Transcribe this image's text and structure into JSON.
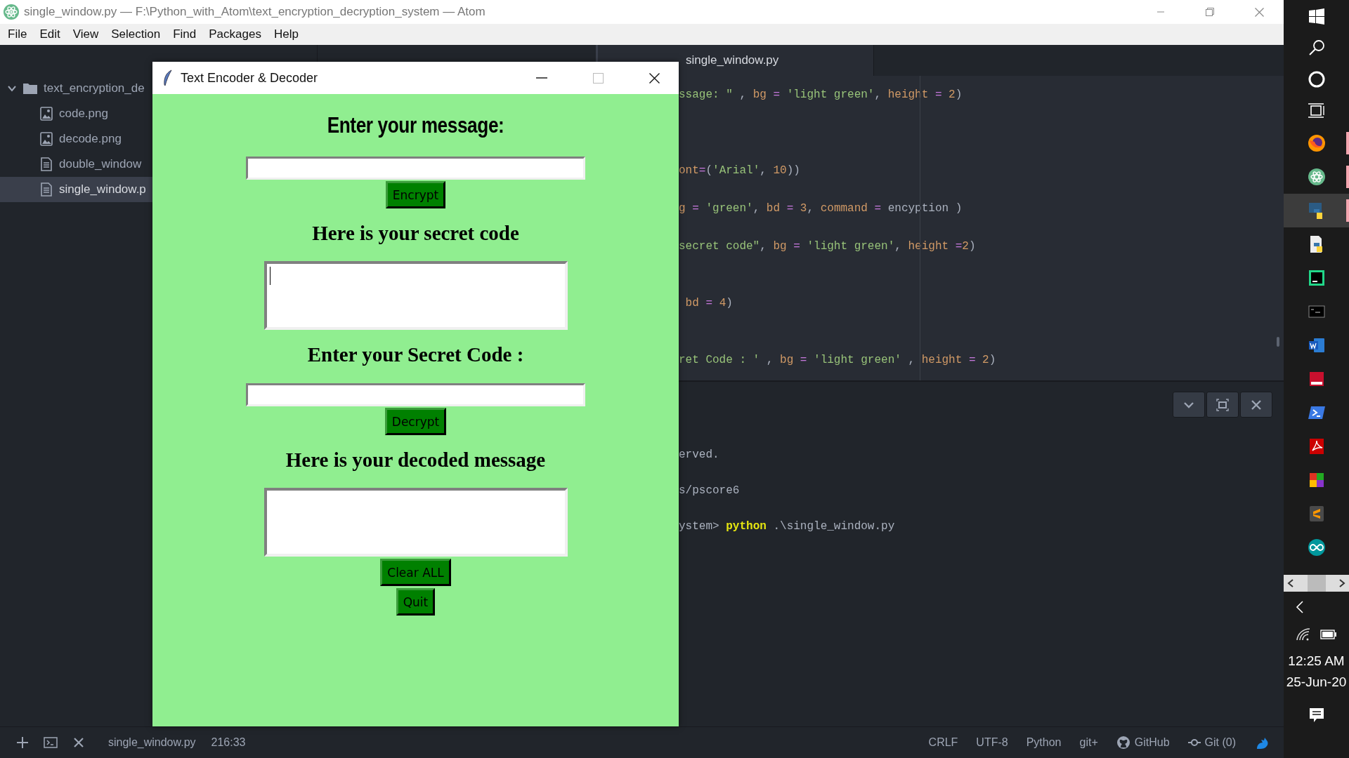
{
  "window": {
    "title": "single_window.py — F:\\Python_with_Atom\\text_encryption_decryption_system — Atom"
  },
  "menu": [
    "File",
    "Edit",
    "View",
    "Selection",
    "Find",
    "Packages",
    "Help"
  ],
  "tree": [
    {
      "label": "text_encryption_de",
      "kind": "folder",
      "expanded": true,
      "selected": false,
      "children": [
        {
          "label": "code.png",
          "kind": "image",
          "selected": false
        },
        {
          "label": "decode.png",
          "kind": "image",
          "selected": false
        },
        {
          "label": "double_window",
          "kind": "file",
          "selected": false
        },
        {
          "label": "single_window.p",
          "kind": "file",
          "selected": true
        }
      ]
    }
  ],
  "editor_tab": {
    "label": "single_window.py",
    "selected": true
  },
  "code_lines": [
    [
      {
        "text": "ssage: \" ",
        "kind": "string"
      },
      {
        "text": ", ",
        "kind": "punct"
      },
      {
        "text": "bg",
        "kind": "param"
      },
      {
        "text": " = ",
        "kind": "op"
      },
      {
        "text": "'light green'",
        "kind": "string"
      },
      {
        "text": ", ",
        "kind": "punct"
      },
      {
        "text": "height",
        "kind": "param"
      },
      {
        "text": " = ",
        "kind": "op"
      },
      {
        "text": "2",
        "kind": "num"
      },
      {
        "text": ")",
        "kind": "punct"
      }
    ],
    [
      {
        "text": "ont",
        "kind": "param"
      },
      {
        "text": "=",
        "kind": "op"
      },
      {
        "text": "(",
        "kind": "punct"
      },
      {
        "text": "'Arial'",
        "kind": "string"
      },
      {
        "text": ", ",
        "kind": "punct"
      },
      {
        "text": "10",
        "kind": "num"
      },
      {
        "text": "))",
        "kind": "punct"
      }
    ],
    [
      {
        "text": "g",
        "kind": "param"
      },
      {
        "text": " = ",
        "kind": "op"
      },
      {
        "text": "'green'",
        "kind": "string"
      },
      {
        "text": ", ",
        "kind": "punct"
      },
      {
        "text": "bd",
        "kind": "param"
      },
      {
        "text": " = ",
        "kind": "op"
      },
      {
        "text": "3",
        "kind": "num"
      },
      {
        "text": ", ",
        "kind": "punct"
      },
      {
        "text": "command",
        "kind": "param"
      },
      {
        "text": " = ",
        "kind": "op"
      },
      {
        "text": "encyption )",
        "kind": "plain"
      }
    ],
    [
      {
        "text": "secret code\"",
        "kind": "string"
      },
      {
        "text": ", ",
        "kind": "punct"
      },
      {
        "text": "bg",
        "kind": "param"
      },
      {
        "text": " = ",
        "kind": "op"
      },
      {
        "text": "'light green'",
        "kind": "string"
      },
      {
        "text": ", ",
        "kind": "punct"
      },
      {
        "text": "height",
        "kind": "param"
      },
      {
        "text": " =",
        "kind": "op"
      },
      {
        "text": "2",
        "kind": "num"
      },
      {
        "text": ")",
        "kind": "punct"
      }
    ],
    [
      {
        "text": " bd",
        "kind": "param"
      },
      {
        "text": " = ",
        "kind": "op"
      },
      {
        "text": "4",
        "kind": "num"
      },
      {
        "text": ")",
        "kind": "punct"
      }
    ],
    [
      {
        "text": "ret Code : ' ",
        "kind": "string"
      },
      {
        "text": ", ",
        "kind": "punct"
      },
      {
        "text": "bg",
        "kind": "param"
      },
      {
        "text": " = ",
        "kind": "op"
      },
      {
        "text": "'light green' ",
        "kind": "string"
      },
      {
        "text": ", ",
        "kind": "punct"
      },
      {
        "text": "height",
        "kind": "param"
      },
      {
        "text": " = ",
        "kind": "op"
      },
      {
        "text": "2",
        "kind": "num"
      },
      {
        "text": ")",
        "kind": "punct"
      }
    ]
  ],
  "terminal_lines": [
    [
      {
        "text": "erved.",
        "kind": "plain"
      }
    ],
    [
      {
        "text": "s/pscore6",
        "kind": "plain"
      }
    ],
    [
      {
        "text": "ystem> ",
        "kind": "plain"
      },
      {
        "text": "python",
        "kind": "command"
      },
      {
        "text": " .\\single_window.py",
        "kind": "plain"
      }
    ]
  ],
  "status_bar": {
    "file": "single_window.py",
    "cursor": "216:33",
    "line_ending": "CRLF",
    "encoding": "UTF-8",
    "grammar": "Python",
    "git_branch": "git+",
    "github": "GitHub",
    "git": "Git (0)"
  },
  "tk_window": {
    "title": "Text Encoder & Decoder",
    "widgets": [
      {
        "kind": "banner",
        "text": "Enter your message:"
      },
      {
        "kind": "entry"
      },
      {
        "kind": "button",
        "label": "Encrypt"
      },
      {
        "kind": "heading",
        "text": "Here is your secret code"
      },
      {
        "kind": "textbox",
        "focused": true
      },
      {
        "kind": "heading",
        "text": "Enter your Secret Code :"
      },
      {
        "kind": "entry"
      },
      {
        "kind": "button",
        "label": "Decrypt"
      },
      {
        "kind": "heading",
        "text": "Here is your decoded message"
      },
      {
        "kind": "textbox",
        "focused": false
      },
      {
        "kind": "button",
        "label": "Clear ALL"
      },
      {
        "kind": "button",
        "label": "Quit"
      }
    ]
  },
  "taskbar": {
    "apps": [
      {
        "running": true,
        "selected": false
      },
      {
        "running": true,
        "selected": false
      },
      {
        "running": true,
        "selected": true
      },
      {
        "running": false,
        "selected": false
      },
      {
        "running": false,
        "selected": false
      },
      {
        "running": false,
        "selected": false
      },
      {
        "running": false,
        "selected": false
      },
      {
        "running": false,
        "selected": false
      },
      {
        "running": false,
        "selected": false
      },
      {
        "running": false,
        "selected": false
      },
      {
        "running": false,
        "selected": false
      },
      {
        "running": false,
        "selected": false
      },
      {
        "running": false,
        "selected": false
      }
    ],
    "time": "12:25 AM",
    "date": "25-Jun-20"
  }
}
